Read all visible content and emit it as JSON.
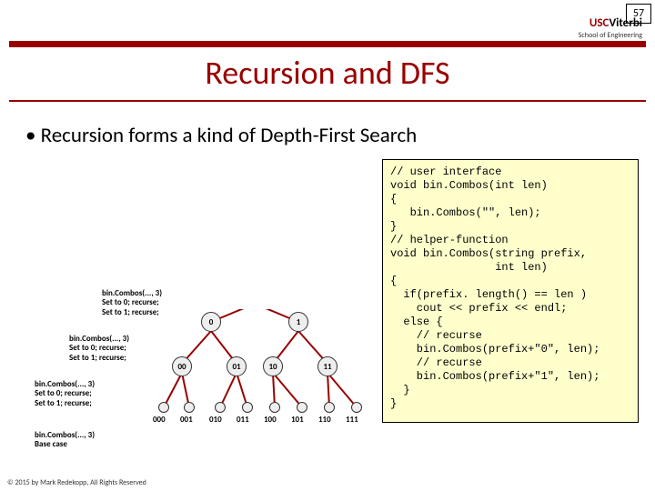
{
  "page_number": "57",
  "logo": {
    "usc": "USC",
    "vit": "Viterbi",
    "sub": "School of Engineering"
  },
  "title": "Recursion and DFS",
  "bullet": "• Recursion forms a kind of Depth-First Search",
  "code": "// user interface\nvoid bin.Combos(int len)\n{\n   bin.Combos(\"\", len);\n}\n// helper-function\nvoid bin.Combos(string prefix,\n                int len)\n{\n  if(prefix. length() == len )\n    cout << prefix << endl;\n  else {\n    // recurse\n    bin.Combos(prefix+\"0\", len);\n    // recurse\n    bin.Combos(prefix+\"1\", len);\n  }\n}",
  "tree": {
    "level1": [
      "0",
      "1"
    ],
    "level2": [
      "00",
      "01",
      "10",
      "11"
    ],
    "level3": [
      "000",
      "001",
      "010",
      "011",
      "100",
      "101",
      "110",
      "111"
    ]
  },
  "anno": {
    "a1": "bin.Combos(..., 3)\nSet to 0; recurse;\nSet to 1; recurse;",
    "a2": "bin.Combos(..., 3)\nSet to 0; recurse;\nSet to 1; recurse;",
    "a3": "bin.Combos(..., 3)\nSet to 0; recurse;\nSet to 1; recurse;",
    "a4": "bin.Combos(..., 3)\nBase case"
  },
  "copyright": "© 2015 by Mark Redekopp, All Rights Reserved"
}
